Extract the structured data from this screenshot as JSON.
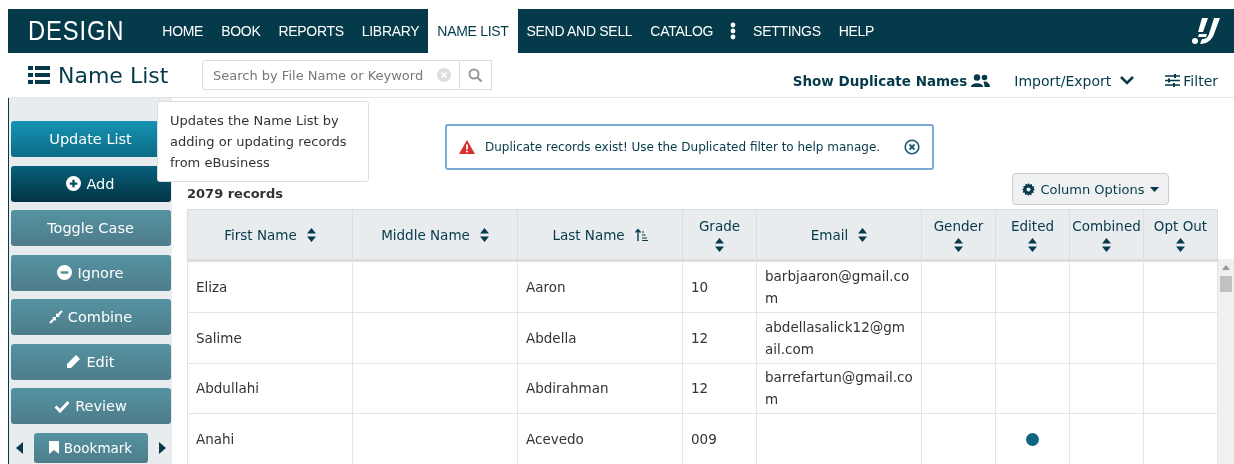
{
  "logo": "DESIGN",
  "nav": [
    {
      "label": "HOME",
      "selected": false
    },
    {
      "label": "BOOK",
      "selected": false
    },
    {
      "label": "REPORTS",
      "selected": false
    },
    {
      "label": "LIBRARY",
      "selected": false
    },
    {
      "label": "NAME LIST",
      "selected": true
    },
    {
      "label": "SEND AND SELL",
      "selected": false
    },
    {
      "label": "CATALOG",
      "selected": false
    },
    {
      "kind": "more"
    },
    {
      "label": "SETTINGS",
      "selected": false
    },
    {
      "label": "HELP",
      "selected": false
    }
  ],
  "page_title": "Name List",
  "search": {
    "placeholder": "Search by File Name or Keyword"
  },
  "toolbar": {
    "duplicates": "Show Duplicate Names",
    "import_export": "Import/Export",
    "filter": "Filter"
  },
  "sidebar": [
    {
      "label": "Update List",
      "kind": "primary"
    },
    {
      "label": "Add",
      "kind": "dark"
    },
    {
      "label": "Toggle Case",
      "kind": "muted"
    },
    {
      "label": "Ignore",
      "kind": "muted"
    },
    {
      "label": "Combine",
      "kind": "muted"
    },
    {
      "label": "Edit",
      "kind": "muted"
    },
    {
      "label": "Review",
      "kind": "muted"
    }
  ],
  "bookmark": "Bookmark",
  "tooltip": "Updates the Name List by adding or updating records from eBusiness",
  "alert": "Duplicate records exist! Use the Duplicated filter to help manage.",
  "record_count": "2079 records",
  "column_options": "Column Options",
  "table": {
    "columns": [
      {
        "label": "First Name",
        "sorted": false
      },
      {
        "label": "Middle Name",
        "sorted": false
      },
      {
        "label": "Last Name",
        "sorted": true
      },
      {
        "label": "Grade",
        "sorted": false
      },
      {
        "label": "Email",
        "sorted": false
      },
      {
        "label": "Gender",
        "sorted": false
      },
      {
        "label": "Edited",
        "sorted": false
      },
      {
        "label": "Combined",
        "sorted": false
      },
      {
        "label": "Opt Out",
        "sorted": false
      }
    ],
    "rows": [
      {
        "first": "Eliza",
        "last": "Aaron",
        "grade": "10",
        "email": "barbjaaron@gmail.com",
        "edited": false
      },
      {
        "first": "Salime",
        "last": "Abdella",
        "grade": "12",
        "email": "abdellasalick12@gmail.com",
        "edited": false
      },
      {
        "first": "Abdullahi",
        "last": "Abdirahman",
        "grade": "12",
        "email": "barrefartun@gmail.com",
        "edited": false
      },
      {
        "first": "Anahi",
        "last": "Acevedo",
        "grade": "009",
        "email": "",
        "edited": true
      }
    ]
  }
}
